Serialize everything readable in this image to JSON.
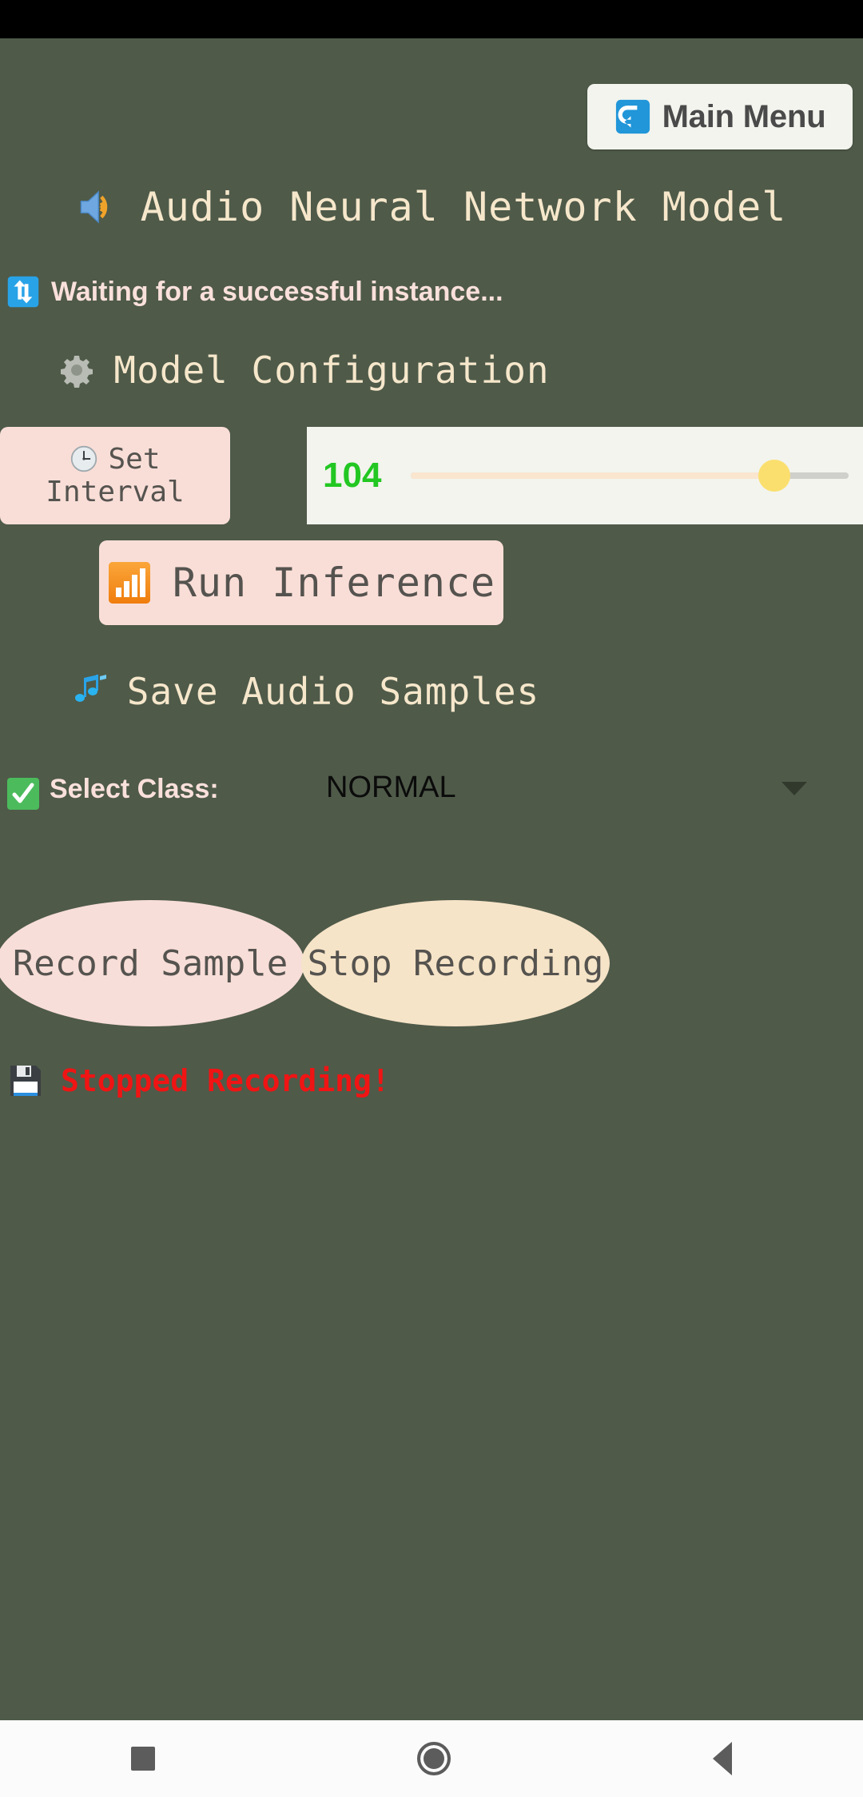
{
  "app": {
    "background_color": "#4f5a49",
    "title": "Audio Neural Network Model",
    "title_icon": "speaker-loud-icon"
  },
  "header": {
    "main_menu_label": "Main Menu",
    "main_menu_icon": "return-arrow-icon"
  },
  "status": {
    "waiting_text": "Waiting for a successful instance...",
    "waiting_icon": "sync-arrows-icon"
  },
  "config": {
    "heading": "Model Configuration",
    "heading_icon": "gear-icon",
    "set_interval_line1": "Set",
    "set_interval_line2": "Interval",
    "set_interval_icon": "clock-icon",
    "slider": {
      "value": "104",
      "value_color": "#22c722",
      "min": 0,
      "max": 125,
      "percent": 83,
      "thumb_color": "#fbdf6e",
      "fill_color": "#fae5cf"
    },
    "run_inference_label": "Run Inference",
    "run_inference_icon": "bar-chart-icon"
  },
  "samples": {
    "heading": "Save Audio Samples",
    "heading_icon": "music-notes-icon",
    "select_class_label": "Select Class:",
    "select_class_icon": "check-mark-icon",
    "selected_class": "NORMAL",
    "record_label": "Record Sample",
    "stop_label": "Stop Recording",
    "record_color": "#f8ded8",
    "stop_color": "#f6e4c8"
  },
  "footer": {
    "stopped_text": "Stopped Recording!",
    "stopped_icon": "floppy-disk-icon",
    "stopped_color": "#f01414"
  },
  "navbar": {
    "recents": "recents-square",
    "home": "home-circle",
    "back": "back-triangle"
  }
}
